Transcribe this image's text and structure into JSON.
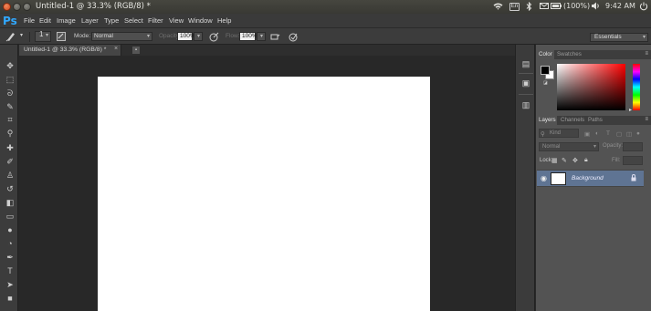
{
  "system": {
    "window_title": "Untitled-1 @ 33.3% (RGB/8) *",
    "tray": {
      "wifi_icon": "wifi-icon",
      "keyboard_layout": "En",
      "bluetooth_icon": "bluetooth-icon",
      "battery_percent": "(100%)",
      "volume_icon": "volume-icon",
      "time": "9:42 AM",
      "power_icon": "power-icon"
    }
  },
  "app": {
    "logo": "Ps",
    "menus": [
      "File",
      "Edit",
      "Image",
      "Layer",
      "Type",
      "Select",
      "Filter",
      "View",
      "Window",
      "Help"
    ]
  },
  "options_bar": {
    "brush_size": "1",
    "mode_label": "Mode:",
    "mode_value": "Normal",
    "opacity_label": "Opacity:",
    "opacity_value": "100%",
    "flow_label": "Flow:",
    "flow_value": "100%",
    "workspace": "Essentials"
  },
  "document": {
    "tab_label": "Untitled-1 @ 33.3% (RGB/8) *",
    "close_glyph": "×"
  },
  "color_panel": {
    "tabs": [
      "Color",
      "Swatches"
    ],
    "active_tab": "Color",
    "foreground": "#000000",
    "background": "#ffffff"
  },
  "layers_panel": {
    "tabs": [
      "Layers",
      "Channels",
      "Paths"
    ],
    "active_tab": "Layers",
    "filter_kind": "Kind",
    "blend_mode": "Normal",
    "opacity_label": "Opacity:",
    "lock_label": "Lock:",
    "fill_label": "Fill:",
    "layers": [
      {
        "name": "Background",
        "visible": true,
        "locked": true
      }
    ]
  }
}
